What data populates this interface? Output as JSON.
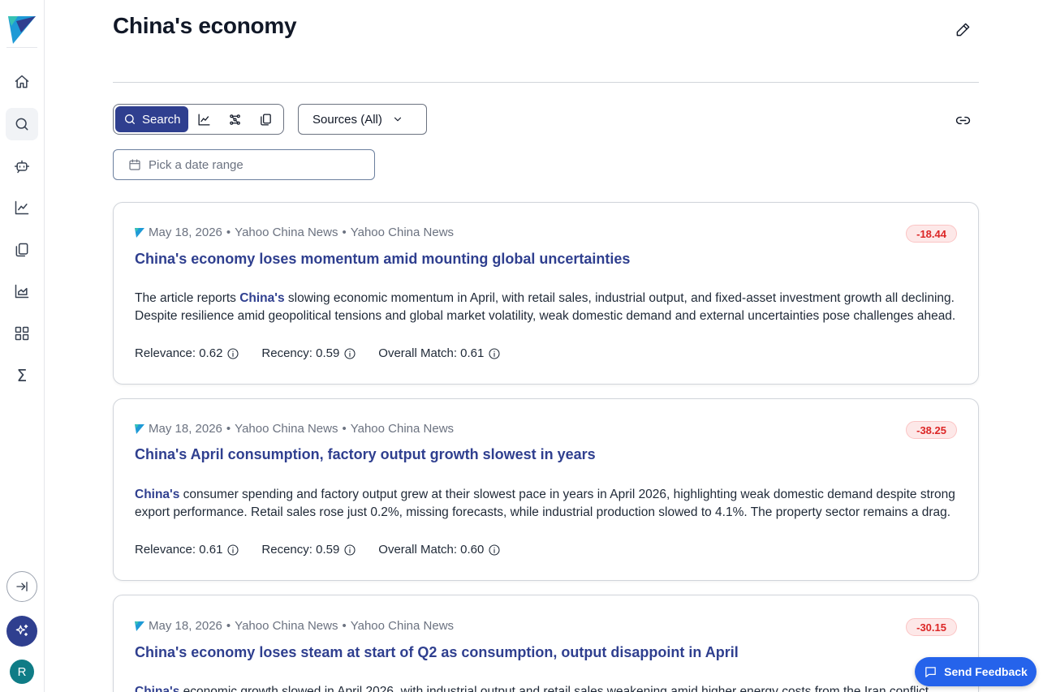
{
  "app": {
    "icons": {
      "logo": "logo-icon",
      "home": "home-icon",
      "search": "search-icon",
      "bot": "bot-icon",
      "chart": "line-chart-icon",
      "docs": "documents-icon",
      "area_chart": "area-chart-icon",
      "dashboard": "dashboard-icon",
      "sigma": "Σ"
    },
    "avatar_initial": "R",
    "brand_color": "#2f3f8f"
  },
  "header": {
    "title": "China's economy"
  },
  "toolbar": {
    "search_label": "Search",
    "sources_label": "Sources (All)",
    "date_placeholder": "Pick a date range"
  },
  "articles": [
    {
      "date": "May 18, 2026",
      "source": "Yahoo China News",
      "publisher": "Yahoo China News",
      "score": "-18.44",
      "title": "China's economy loses momentum amid mounting global uncertainties",
      "highlight": "China's",
      "summary_before": "The article reports ",
      "summary_after": " slowing economic momentum in April, with retail sales, industrial output, and fixed-asset investment growth all declining. Despite resilience amid geopolitical tensions and global market volatility, weak domestic demand and external uncertainties pose challenges ahead.",
      "relevance": "Relevance: 0.62",
      "recency": "Recency: 0.59",
      "overall": "Overall Match: 0.61"
    },
    {
      "date": "May 18, 2026",
      "source": "Yahoo China News",
      "publisher": "Yahoo China News",
      "score": "-38.25",
      "title": "China's April consumption, factory output growth slowest in years",
      "highlight": "China's",
      "summary_before": "",
      "summary_after": " consumer spending and factory output grew at their slowest pace in years in April 2026, highlighting weak domestic demand despite strong export performance. Retail sales rose just 0.2%, missing forecasts, while industrial production slowed to 4.1%. The property sector remains a drag.",
      "relevance": "Relevance: 0.61",
      "recency": "Recency: 0.59",
      "overall": "Overall Match: 0.60"
    },
    {
      "date": "May 18, 2026",
      "source": "Yahoo China News",
      "publisher": "Yahoo China News",
      "score": "-30.15",
      "title": "China's economy loses steam at start of Q2 as consumption, output disappoint in April",
      "highlight": "China's",
      "summary_before": "",
      "summary_after": " economic growth slowed in April 2026, with industrial output and retail sales weakening amid higher energy costs from the Iran conflict.",
      "relevance": "",
      "recency": "",
      "overall": ""
    }
  ],
  "feedback": {
    "label": "Send Feedback"
  },
  "colors": {
    "accent": "#2f3f8f",
    "negative_score": "#dc2626",
    "feedback_button": "#2563eb"
  }
}
